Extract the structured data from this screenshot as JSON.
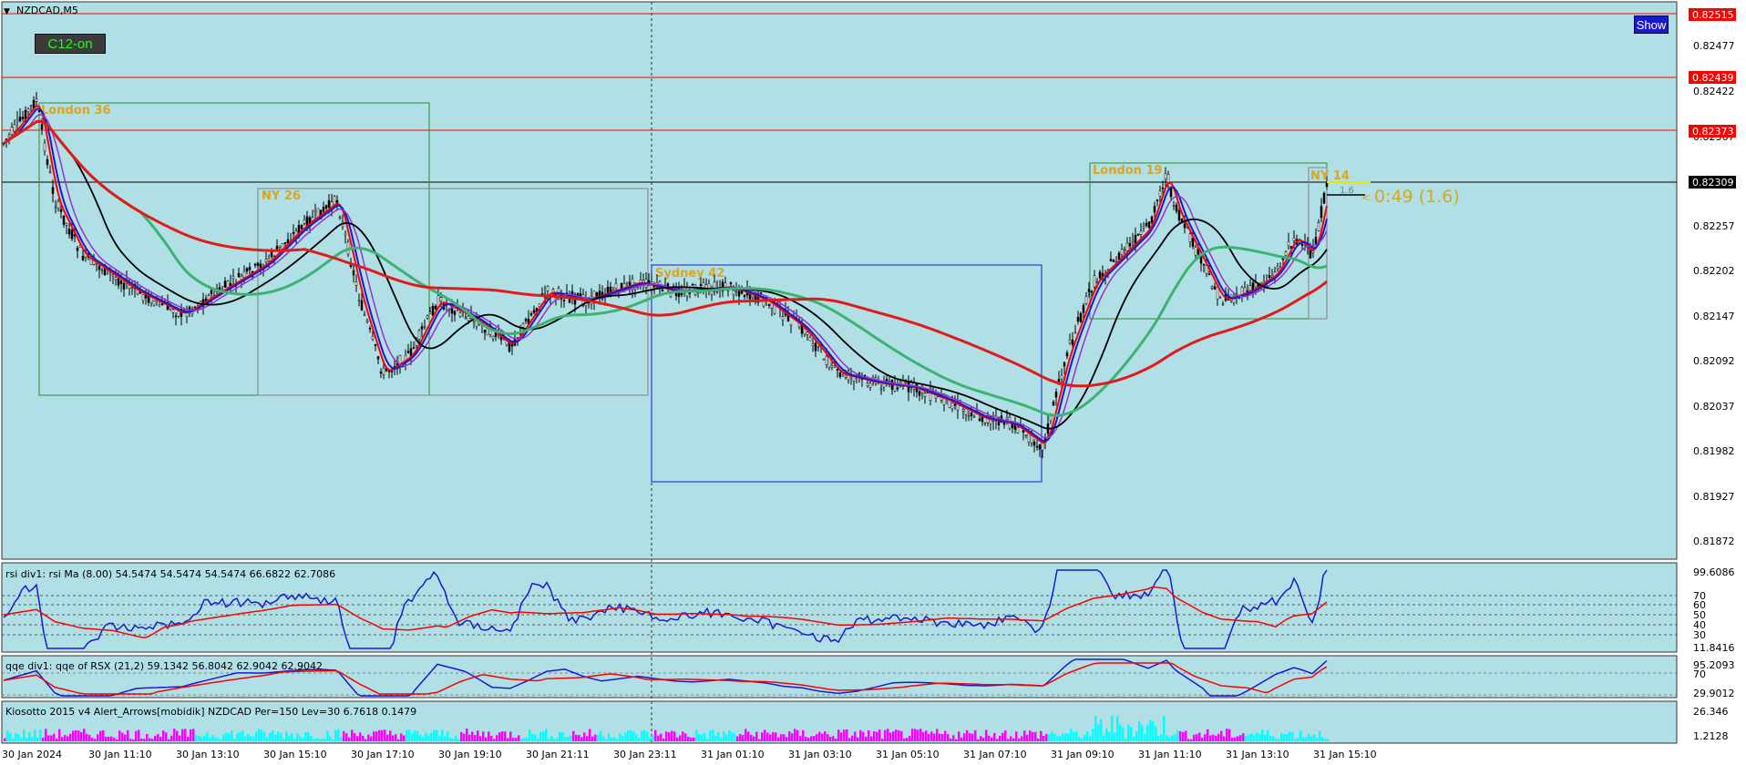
{
  "window": {
    "title": "NZDCAD,M5",
    "menu_glyph": "▼"
  },
  "buttons": {
    "c12_label": "C12-on",
    "show_label": "Show"
  },
  "colors": {
    "background": "#b0dfe5",
    "bull_ma": "#1a1acd",
    "ema_purple": "#9932cc",
    "ema_red": "#ff0000",
    "ma_black": "#000000",
    "ma_green": "#3cb371",
    "ma_slow_red": "#e31a1a",
    "session_green": "#2e8b2e",
    "session_blue": "#1a1acd",
    "session_label": "#daa520",
    "histogram_cyan": "#00ffff",
    "histogram_magenta": "#ff00ff"
  },
  "price_axis": {
    "ticks": [
      "0.82477",
      "0.82422",
      "0.82367",
      "0.82257",
      "0.82202",
      "0.82147",
      "0.82092",
      "0.82037",
      "0.81982",
      "0.81927",
      "0.81872"
    ],
    "marked_levels": [
      {
        "label": "0.82515",
        "color": "#ff0000"
      },
      {
        "label": "0.82439",
        "color": "#ff0000"
      },
      {
        "label": "0.82373",
        "color": "#ff0000"
      },
      {
        "label": "0.82309",
        "color": "#000000"
      }
    ]
  },
  "sessions": [
    {
      "label": "London 36",
      "color": "#2e8b2e"
    },
    {
      "label": "NY 26",
      "color": "#808080"
    },
    {
      "label": "Sydney 42",
      "color": "#1a1acd"
    },
    {
      "label": "London 19",
      "color": "#2e8b2e"
    },
    {
      "label": "NY 14",
      "color": "#808080"
    }
  ],
  "countdown": {
    "timer": "0:49 (1.6)",
    "spread": "1.6"
  },
  "time_axis": [
    "30 Jan 2024",
    "30 Jan 11:10",
    "30 Jan 13:10",
    "30 Jan 15:10",
    "30 Jan 17:10",
    "30 Jan 19:10",
    "30 Jan 21:11",
    "30 Jan 23:11",
    "31 Jan 01:10",
    "31 Jan 03:10",
    "31 Jan 05:10",
    "31 Jan 07:10",
    "31 Jan 09:10",
    "31 Jan 11:10",
    "31 Jan 13:10",
    "31 Jan 15:10"
  ],
  "indicators": {
    "rsi": {
      "title": "rsi div1: rsi Ma (8.00) 54.5474 54.5474 54.5474 66.6822 62.7086",
      "scale_max": "99.6086",
      "scale_min": "11.8416",
      "levels": [
        "70",
        "60",
        "50",
        "40",
        "30"
      ]
    },
    "qqe": {
      "title": "qqe div1: qqe of RSX (21,2) 59.1342 56.8042 62.9042 62.9042",
      "scale_max": "95.2093",
      "level": "70",
      "scale_min": "29.9012",
      "scale_min_extra": "30"
    },
    "kiosotto": {
      "title": "Kiosotto 2015 v4 Alert_Arrows[mobidik] NZDCAD Per=150 Lev=30 6.7618 0.1479",
      "scale_max": "26.346",
      "scale_min": "1.2128"
    }
  }
}
